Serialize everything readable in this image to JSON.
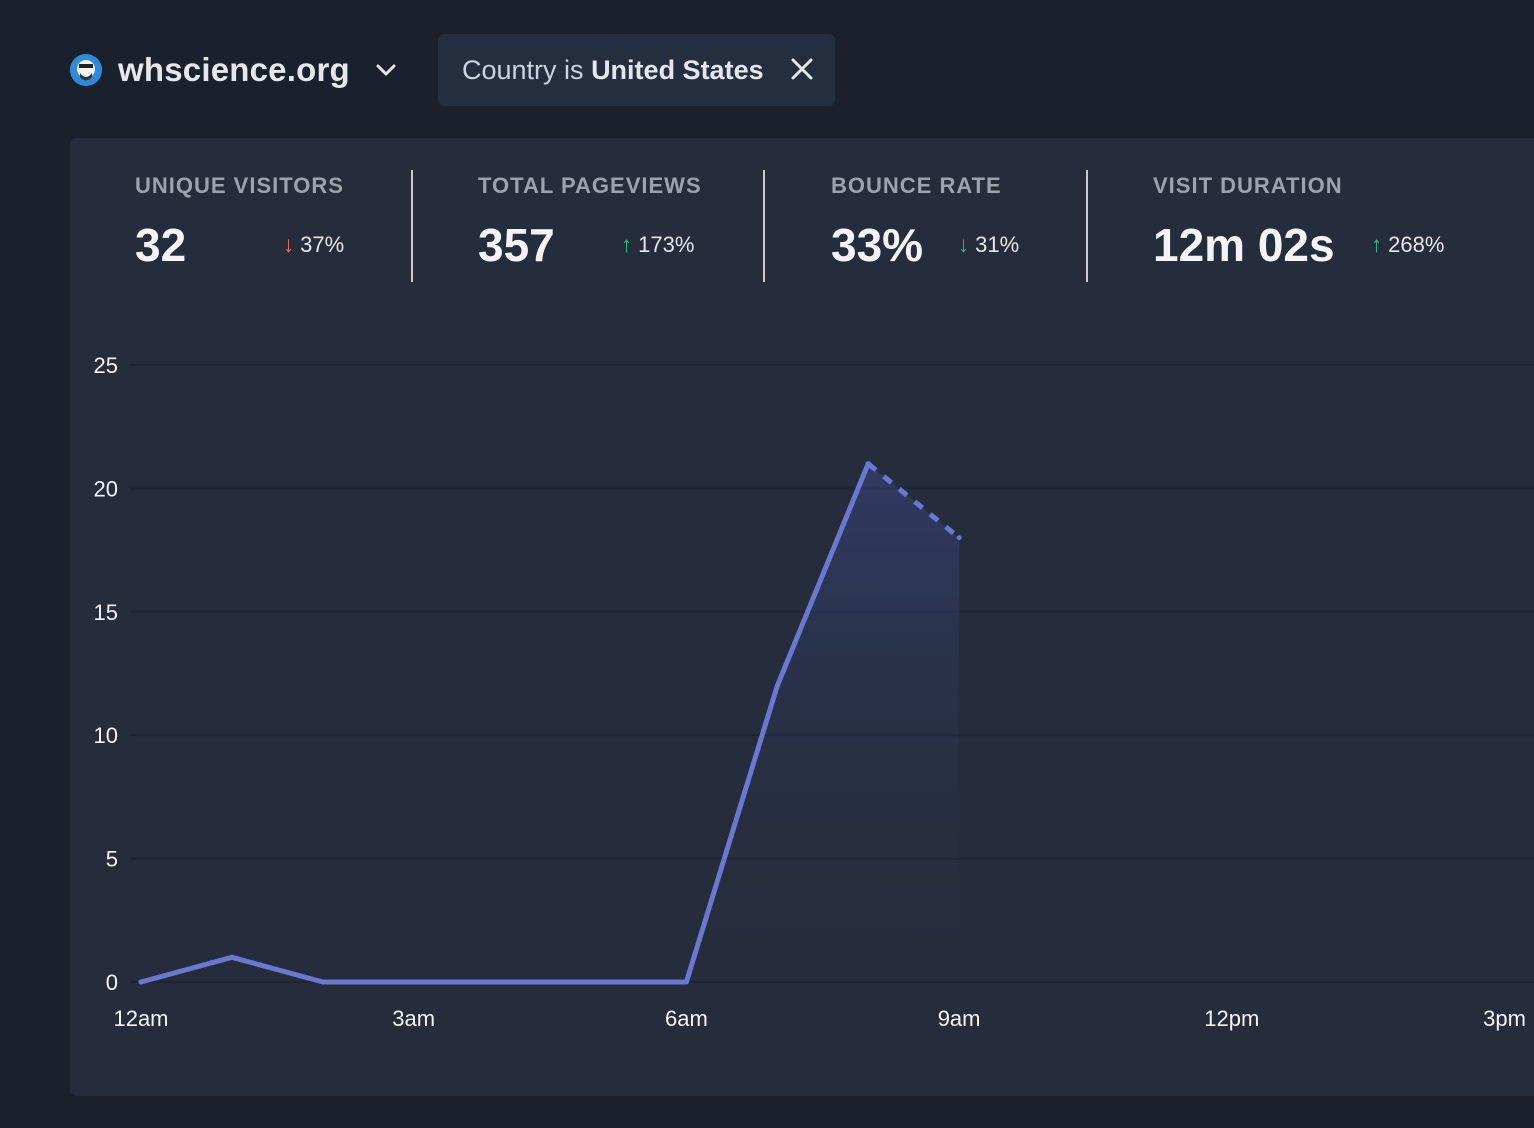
{
  "site": {
    "name": "whscience.org"
  },
  "filter": {
    "prefix": "Country is",
    "value": "United States"
  },
  "stats": [
    {
      "label": "UNIQUE VISITORS",
      "value": "32",
      "change": "37%",
      "direction": "down"
    },
    {
      "label": "TOTAL PAGEVIEWS",
      "value": "357",
      "change": "173%",
      "direction": "up"
    },
    {
      "label": "BOUNCE RATE",
      "value": "33%",
      "change": "31%",
      "direction": "down"
    },
    {
      "label": "VISIT DURATION",
      "value": "12m 02s",
      "change": "268%",
      "direction": "up"
    }
  ],
  "icons": {
    "down_arrow": "↓",
    "up_arrow": "↑"
  },
  "colors": {
    "line": "#6b77d1",
    "up": "#22c08a",
    "down": "#ef6b6b"
  },
  "chart_data": {
    "type": "line",
    "x_labels": [
      "12am",
      "3am",
      "6am",
      "9am",
      "12pm",
      "3pm"
    ],
    "y_ticks": [
      0,
      5,
      10,
      15,
      20,
      25
    ],
    "ylim": [
      0,
      25
    ],
    "x_hours": [
      0,
      1,
      2,
      3,
      4,
      5,
      6,
      7,
      8,
      9
    ],
    "values": [
      0,
      1,
      0,
      0,
      0,
      0,
      0,
      12,
      21,
      18
    ],
    "incomplete_from_hour": 8,
    "grid": true
  }
}
